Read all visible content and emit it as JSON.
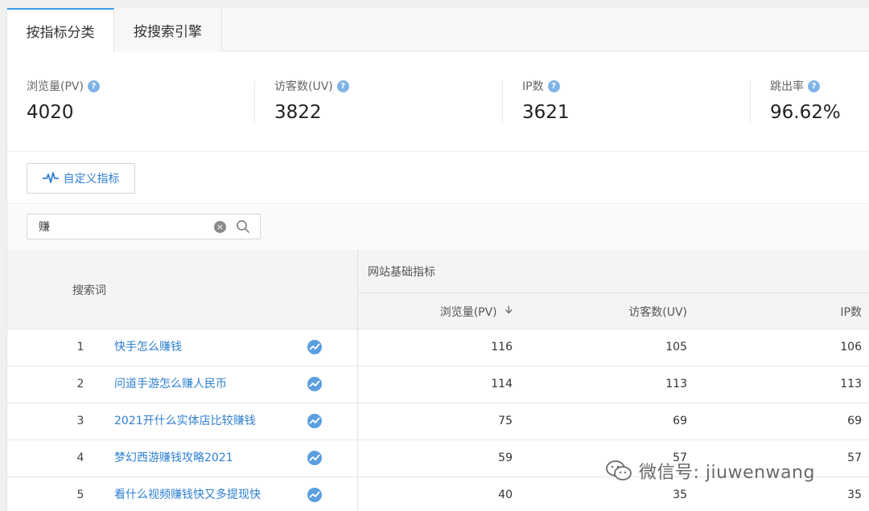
{
  "tabs": [
    {
      "label": "按指标分类",
      "active": true
    },
    {
      "label": "按搜索引擎",
      "active": false
    }
  ],
  "metrics": [
    {
      "label": "浏览量(PV)",
      "value": "4020"
    },
    {
      "label": "访客数(UV)",
      "value": "3822"
    },
    {
      "label": "IP数",
      "value": "3621"
    },
    {
      "label": "跳出率",
      "value": "96.62%"
    }
  ],
  "custom_metrics_button": "自定义指标",
  "search": {
    "value": "赚",
    "placeholder": ""
  },
  "table": {
    "keyword_header": "搜索词",
    "group_header": "网站基础指标",
    "columns": [
      "浏览量(PV)",
      "访客数(UV)",
      "IP数"
    ],
    "rows": [
      {
        "index": "1",
        "keyword": "快手怎么赚钱",
        "pv": "116",
        "uv": "105",
        "ip": "106"
      },
      {
        "index": "2",
        "keyword": "问道手游怎么赚人民币",
        "pv": "114",
        "uv": "113",
        "ip": "113"
      },
      {
        "index": "3",
        "keyword": "2021开什么实体店比较赚钱",
        "pv": "75",
        "uv": "69",
        "ip": "69"
      },
      {
        "index": "4",
        "keyword": "梦幻西游赚钱攻略2021",
        "pv": "59",
        "uv": "57",
        "ip": "57"
      },
      {
        "index": "5",
        "keyword": "看什么视频赚钱快又多提现快",
        "pv": "40",
        "uv": "35",
        "ip": "35"
      }
    ]
  },
  "watermark": "微信号: jiuwenwang",
  "colors": {
    "accent": "#3a9be8",
    "link": "#2f7fd0"
  }
}
